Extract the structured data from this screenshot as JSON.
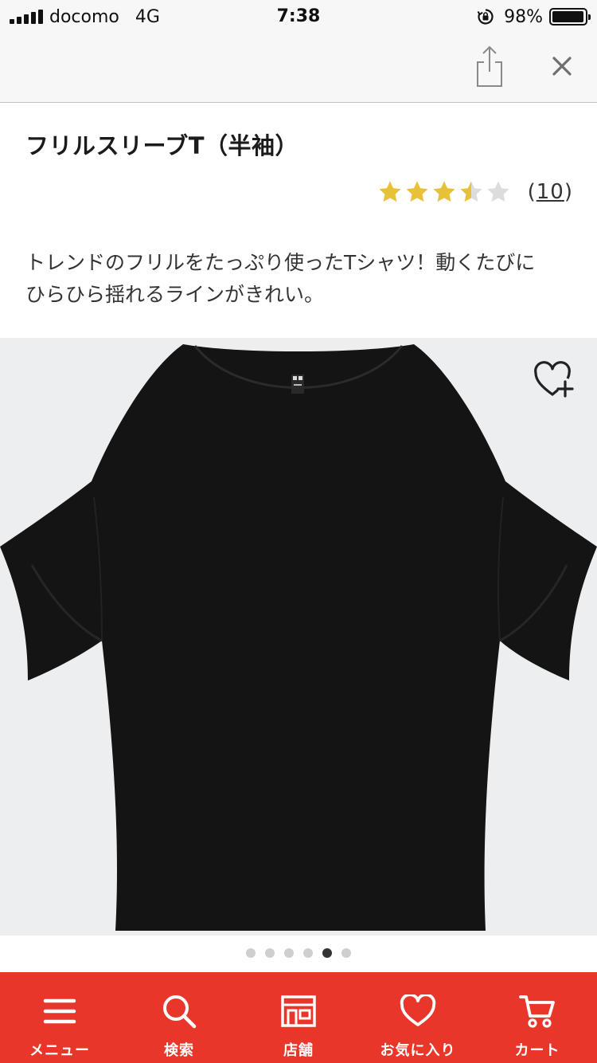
{
  "status_bar": {
    "carrier": "docomo",
    "network": "4G",
    "time": "7:38",
    "battery_percent": "98%",
    "battery_level": 0.98,
    "icons": [
      "signal-icon",
      "orientation-lock-icon",
      "battery-icon"
    ]
  },
  "toolbar": {
    "icons": [
      "share-icon",
      "close-icon"
    ]
  },
  "product": {
    "title": "フリルスリーブT（半袖）",
    "rating_value": 3.5,
    "rating_max": 5,
    "review_count_open": "(",
    "review_count": "10",
    "review_count_close": ")",
    "description_line1": "トレンドのフリルをたっぷり使ったTシャツ！動くたびに",
    "description_line2": "ひらひら揺れるラインがきれい。"
  },
  "gallery": {
    "image_count": 6,
    "active_index": 4,
    "favorite_icon": "heart-plus-icon"
  },
  "bottom_nav": {
    "items": [
      {
        "label": "メニュー",
        "icon": "menu-icon"
      },
      {
        "label": "検索",
        "icon": "search-icon"
      },
      {
        "label": "店舗",
        "icon": "store-icon"
      },
      {
        "label": "お気に入り",
        "icon": "heart-icon"
      },
      {
        "label": "カート",
        "icon": "cart-icon"
      }
    ]
  },
  "colors": {
    "brand_red": "#e8372a",
    "star_gold": "#e8c13a",
    "star_empty": "#dcdcdc"
  }
}
